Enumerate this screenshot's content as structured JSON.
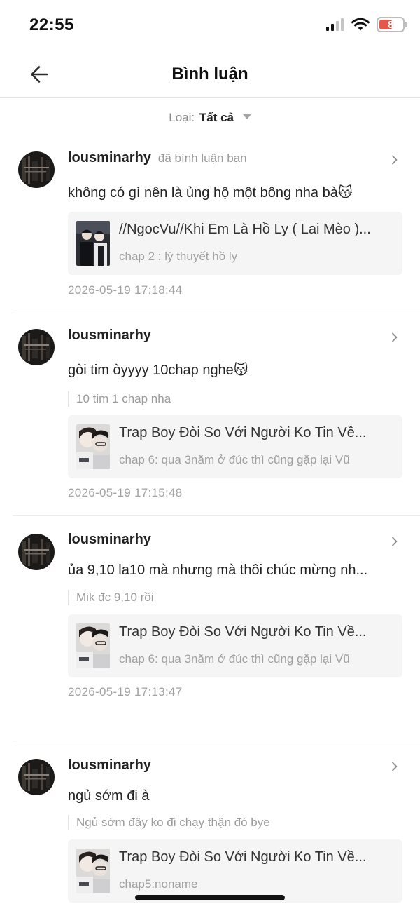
{
  "status_bar": {
    "time": "22:55",
    "battery_level": "8",
    "battery_color": "#e4574a"
  },
  "header": {
    "title": "Bình luận",
    "back_icon": "arrow-left-icon"
  },
  "filter": {
    "label": "Loại:",
    "value": "Tất cả"
  },
  "comments": [
    {
      "username": "lousminarhy",
      "action": "đã bình luận bạn",
      "text": "không có gì nên là ủng hộ một bông nha bà😽",
      "quote": "",
      "story_title": "//NgocVu//Khi Em Là Hồ Ly ( Lai Mèo )...",
      "story_chapter": "chap 2 : lý thuyết hồ ly",
      "timestamp": "2026-05-19 17:18:44"
    },
    {
      "username": "lousminarhy",
      "action": "",
      "text": "gòi tim òyyyy 10chap nghe😽",
      "quote": "10 tim 1 chap nha",
      "story_title": "Trap Boy Đòi So Với Người Ko Tin Về...",
      "story_chapter": "chap 6: qua 3năm ở đúc thì cũng gặp lại Vũ",
      "timestamp": "2026-05-19 17:15:48"
    },
    {
      "username": "lousminarhy",
      "action": "",
      "text": "ủa 9,10 la10 mà nhưng mà thôi chúc mừng nh...",
      "quote": "Mik đc 9,10 rồi",
      "story_title": "Trap Boy Đòi So Với Người Ko Tin Về...",
      "story_chapter": "chap 6: qua 3năm ở đúc thì cũng gặp lại Vũ",
      "timestamp": "2026-05-19 17:13:47"
    },
    {
      "username": "lousminarhy",
      "action": "",
      "text": "ngủ sớm đi à",
      "quote": "Ngủ sớm đây ko đi chạy thận đó bye",
      "story_title": "Trap Boy Đòi So Với Người Ko Tin Về...",
      "story_chapter": "chap5:noname",
      "timestamp": ""
    }
  ]
}
